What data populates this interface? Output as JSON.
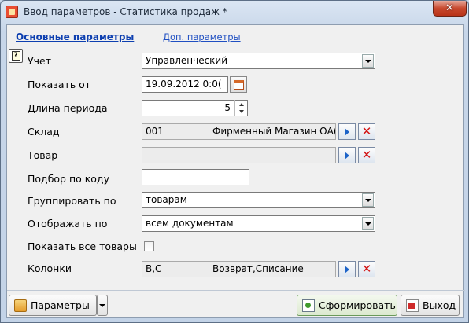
{
  "window": {
    "title": "Ввод параметров - Статистика продаж *",
    "close_label": "✕"
  },
  "tabs": [
    {
      "label": "Основные параметры",
      "active": true
    },
    {
      "label": "Доп. параметры",
      "active": false
    }
  ],
  "help_icon_text": "?",
  "fields": {
    "uchet": {
      "label": "Учет",
      "value": "Управленческий"
    },
    "date_from": {
      "label": "Показать от",
      "value": "19.09.2012 0:0("
    },
    "period_length": {
      "label": "Длина периода",
      "value": "5"
    },
    "sklad": {
      "label": "Склад",
      "code": "001",
      "name": "Фирменный Магазин ОА("
    },
    "tovar": {
      "label": "Товар",
      "code": "",
      "name": ""
    },
    "podbor": {
      "label": "Подбор по коду",
      "value": ""
    },
    "group_by": {
      "label": "Группировать по",
      "value": "товарам"
    },
    "display_by": {
      "label": "Отображать по",
      "value": "всем документам"
    },
    "show_all": {
      "label": "Показать все товары",
      "checked": false
    },
    "kolonki": {
      "label": "Колонки",
      "code": "В,С",
      "name": "Возврат,Списание"
    }
  },
  "clear_glyph": "✕",
  "buttons": {
    "params": "Параметры",
    "run": "Сформировать",
    "exit": "Выход"
  },
  "colors": {
    "tab_link": "#0d3fb0",
    "clear_red": "#d31515",
    "pick_blue": "#1c63c8"
  }
}
